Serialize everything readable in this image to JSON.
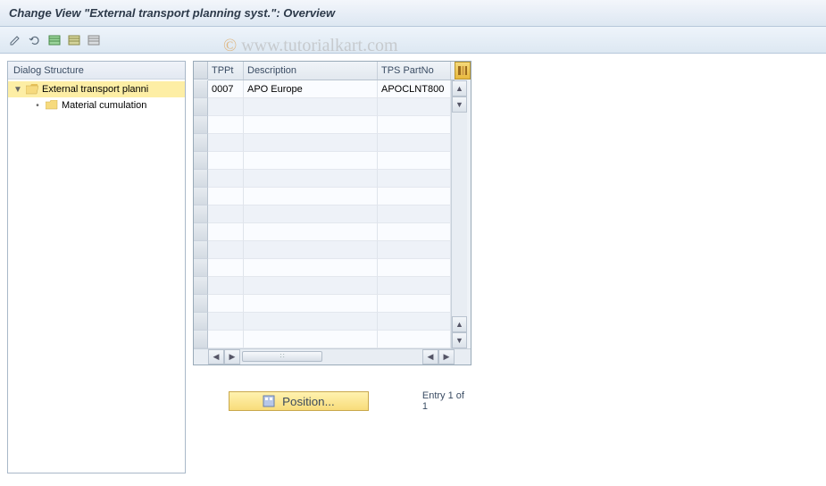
{
  "title": "Change View \"External transport planning syst.\": Overview",
  "watermark": "www.tutorialkart.com",
  "toolbar": {
    "btn1": "✎",
    "btn2": "↺",
    "btn3": "select-all",
    "btn4": "new-entries",
    "btn5": "delete"
  },
  "tree": {
    "header": "Dialog Structure",
    "items": [
      {
        "label": "External transport planni",
        "selected": true,
        "open": true
      },
      {
        "label": "Material cumulation",
        "selected": false,
        "open": false
      }
    ]
  },
  "grid": {
    "columns": [
      {
        "key": "tppt",
        "label": "TPPt"
      },
      {
        "key": "desc",
        "label": "Description"
      },
      {
        "key": "part",
        "label": "TPS PartNo"
      }
    ],
    "rows": [
      {
        "tppt": "0007",
        "desc": "APO Europe",
        "part": "APOCLNT800"
      },
      {
        "tppt": "",
        "desc": "",
        "part": ""
      },
      {
        "tppt": "",
        "desc": "",
        "part": ""
      },
      {
        "tppt": "",
        "desc": "",
        "part": ""
      },
      {
        "tppt": "",
        "desc": "",
        "part": ""
      },
      {
        "tppt": "",
        "desc": "",
        "part": ""
      },
      {
        "tppt": "",
        "desc": "",
        "part": ""
      },
      {
        "tppt": "",
        "desc": "",
        "part": ""
      },
      {
        "tppt": "",
        "desc": "",
        "part": ""
      },
      {
        "tppt": "",
        "desc": "",
        "part": ""
      },
      {
        "tppt": "",
        "desc": "",
        "part": ""
      },
      {
        "tppt": "",
        "desc": "",
        "part": ""
      },
      {
        "tppt": "",
        "desc": "",
        "part": ""
      },
      {
        "tppt": "",
        "desc": "",
        "part": ""
      },
      {
        "tppt": "",
        "desc": "",
        "part": ""
      }
    ]
  },
  "footer": {
    "position_label": "Position...",
    "entry_text": "Entry 1 of 1"
  }
}
